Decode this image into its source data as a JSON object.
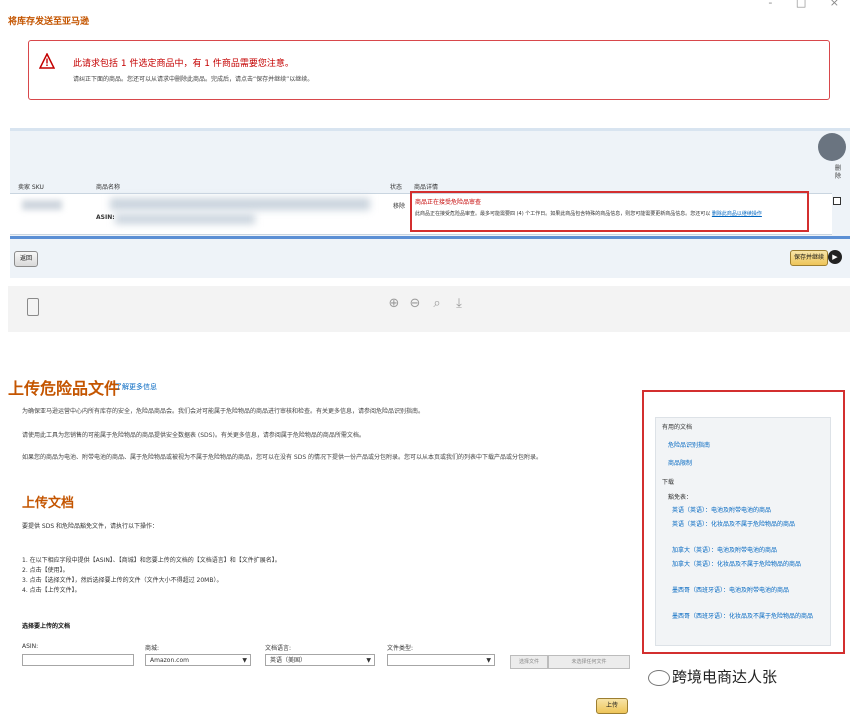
{
  "window": {
    "controls": "- □ ×"
  },
  "top": {
    "title": "将库存发送至亚马逊"
  },
  "alert": {
    "headline": "此请求包括 1 件选定商品中，有 1 件商品需要您注意。",
    "sub": "请纠正下面的商品。您还可以从请求中删除此商品。完成后，请点击“保存并继续”以继续。"
  },
  "table": {
    "side_label": "删除",
    "headers": [
      "卖家 SKU",
      "商品名称",
      "状态",
      "商品详情"
    ],
    "row": {
      "asin_label": "ASIN:",
      "status": "移除",
      "detail_title": "商品正在接受危险品审查",
      "detail_desc": "此商品正在接受危险品审查。最多可能需要四 (4) 个工作日。如果此商品包含特殊的商品信息，则您可能需要更新商品信息。您还可以",
      "detail_link": "删除此商品以继续操作"
    },
    "btn_back": "返回",
    "btn_save": "保存并继续"
  },
  "upload": {
    "title": "上传危险品文件",
    "learn_more": "了解更多信息",
    "para1": "为确保亚马逊运营中心内所有库存的安全，危险品商品会。我们会对可能属于危险物品的商品进行审核和检查。有关更多信息，请参阅危险品识别指南。",
    "para2": "请使用此工具为您销售的可能属于危险物品的商品提供安全数据表 (SDS)。有关更多信息，请参阅属于危险物品的商品所需文档。",
    "para3": "如果您的商品为电池、附带电池的商品、属于危险物品或被视为不属于危险物品的商品，您可以在没有 SDS 的情况下提供一份产品或分包附录。您可以从本页或我们的列表中下载产品或分包附录。",
    "doc_title": "上传文档",
    "instr": "要提供 SDS 和危险品豁免文件，请执行以下操作：",
    "steps": [
      "1. 在以下相应字段中提供【ASIN】、【商城】和您要上传的文档的【文档语言】和【文件扩展名】。",
      "2. 点击【使用】。",
      "3. 点击【选择文件】，然后选择要上传的文件（文件大小不得超过 20MB）。",
      "4. 点击【上传文件】。"
    ],
    "choose_title": "选择要上传的文档",
    "asin_label": "ASIN:",
    "market_label": "商城:",
    "market_value": "Amazon.com",
    "doclang_label": "文档语言:",
    "doclang_value": "英语（美国）",
    "filetype_label": "文件类型:",
    "filetype_value": "",
    "btn_choose": "选择文件",
    "btn_nofile": "未选择任何文件",
    "btn_upload": "上传"
  },
  "sidebar": {
    "section1": "有用的文档",
    "links1": [
      "危险品识别指南",
      "商品限制"
    ],
    "section2": "下载",
    "subsection": "豁免表：",
    "links2": [
      "英语（英语）：电池及附带电池的商品",
      "英语（英语）：化妆品及不属于危险物品的商品",
      "加拿大（英语）：电池及附带电池的商品",
      "加拿大（英语）：化妆品及不属于危险物品的商品",
      "墨西哥（西班牙语）：电池及附带电池的商品",
      "墨西哥（西班牙语）：化妆品及不属于危险物品的商品"
    ]
  },
  "watermark": {
    "text": "跨境电商达人张"
  },
  "colors": {
    "accent": "#c45500",
    "alert_red": "#d32f2f",
    "link": "#0066c0",
    "blue_line": "#5b8fd4"
  }
}
